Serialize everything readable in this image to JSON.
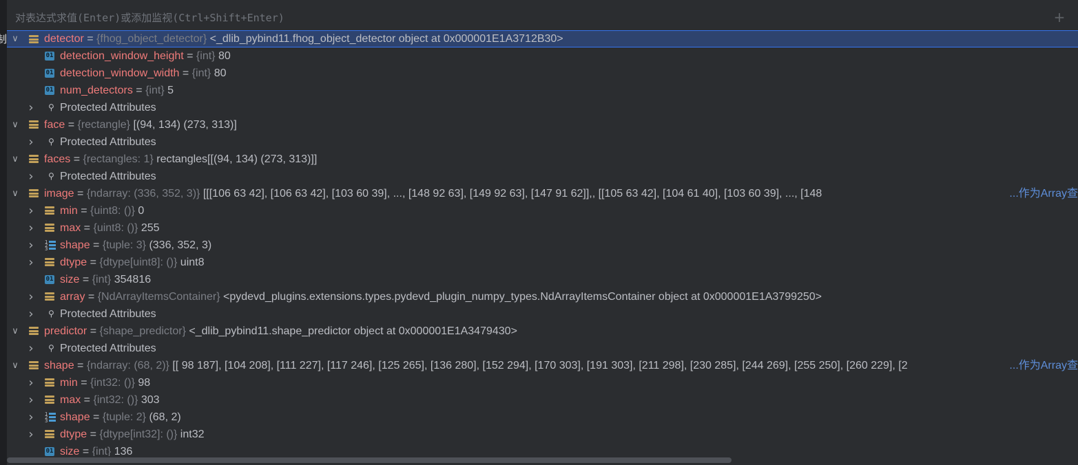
{
  "left_stub_glyph": "制",
  "eval_bar": {
    "placeholder": "对表达式求值(Enter)或添加监视(Ctrl+Shift+Enter)"
  },
  "view_as_array": "...作为Array查",
  "tree": [
    {
      "level": 0,
      "expanded": true,
      "icon": "obj",
      "selected": true,
      "name": "detector",
      "type": "{fhog_object_detector}",
      "value": "<_dlib_pybind11.fhog_object_detector object at 0x000001E1A3712B30>"
    },
    {
      "level": 1,
      "icon": "num",
      "name": "detection_window_height",
      "type": "{int}",
      "value": "80"
    },
    {
      "level": 1,
      "icon": "num",
      "name": "detection_window_width",
      "type": "{int}",
      "value": "80"
    },
    {
      "level": 1,
      "icon": "num",
      "name": "num_detectors",
      "type": "{int}",
      "value": "5"
    },
    {
      "level": 1,
      "expanded": false,
      "icon": "key",
      "plain": "Protected Attributes"
    },
    {
      "level": 0,
      "expanded": true,
      "icon": "obj",
      "name": "face",
      "type": "{rectangle}",
      "value": "[(94, 134) (273, 313)]"
    },
    {
      "level": 1,
      "expanded": false,
      "icon": "key",
      "plain": "Protected Attributes"
    },
    {
      "level": 0,
      "expanded": true,
      "icon": "obj",
      "name": "faces",
      "type": "{rectangles: 1}",
      "value": "rectangles[[(94, 134) (273, 313)]]"
    },
    {
      "level": 1,
      "expanded": false,
      "icon": "key",
      "plain": "Protected Attributes"
    },
    {
      "level": 0,
      "expanded": true,
      "icon": "obj",
      "name": "image",
      "type": "{ndarray: (336, 352, 3)}",
      "value": "[[[106  63  42],  [106  63  42],  [103  60  39],  ...,  [148  92  63],  [149  92  63],  [147  91  62]],, [[105  63  42],  [104  61  40],  [103  60  39],  ...,  [148",
      "link": true
    },
    {
      "level": 1,
      "expanded": false,
      "icon": "obj",
      "name": "min",
      "type": "{uint8: ()}",
      "value": "0"
    },
    {
      "level": 1,
      "expanded": false,
      "icon": "obj",
      "name": "max",
      "type": "{uint8: ()}",
      "value": "255"
    },
    {
      "level": 1,
      "expanded": false,
      "icon": "list",
      "name": "shape",
      "type": "{tuple: 3}",
      "value": "(336, 352, 3)"
    },
    {
      "level": 1,
      "expanded": false,
      "icon": "obj",
      "name": "dtype",
      "type": "{dtype[uint8]: ()}",
      "value": "uint8"
    },
    {
      "level": 1,
      "icon": "num",
      "name": "size",
      "type": "{int}",
      "value": "354816"
    },
    {
      "level": 1,
      "expanded": false,
      "icon": "obj",
      "name": "array",
      "type": "{NdArrayItemsContainer}",
      "value": "<pydevd_plugins.extensions.types.pydevd_plugin_numpy_types.NdArrayItemsContainer object at 0x000001E1A3799250>"
    },
    {
      "level": 1,
      "expanded": false,
      "icon": "key",
      "plain": "Protected Attributes"
    },
    {
      "level": 0,
      "expanded": true,
      "icon": "obj",
      "name": "predictor",
      "type": "{shape_predictor}",
      "value": "<_dlib_pybind11.shape_predictor object at 0x000001E1A3479430>"
    },
    {
      "level": 1,
      "expanded": false,
      "icon": "key",
      "plain": "Protected Attributes"
    },
    {
      "level": 0,
      "expanded": true,
      "icon": "obj",
      "name": "shape",
      "type": "{ndarray: (68, 2)}",
      "value": "[[ 98 187], [104 208], [111 227], [117 246], [125 265], [136 280], [152 294], [170 303], [191 303], [211 298], [230 285], [244 269], [255 250], [260 229], [2",
      "link": true
    },
    {
      "level": 1,
      "expanded": false,
      "icon": "obj",
      "name": "min",
      "type": "{int32: ()}",
      "value": "98"
    },
    {
      "level": 1,
      "expanded": false,
      "icon": "obj",
      "name": "max",
      "type": "{int32: ()}",
      "value": "303"
    },
    {
      "level": 1,
      "expanded": false,
      "icon": "list",
      "name": "shape",
      "type": "{tuple: 2}",
      "value": "(68, 2)"
    },
    {
      "level": 1,
      "expanded": false,
      "icon": "obj",
      "name": "dtype",
      "type": "{dtype[int32]: ()}",
      "value": "int32"
    },
    {
      "level": 1,
      "icon": "num",
      "name": "size",
      "type": "{int}",
      "value": "136"
    }
  ]
}
